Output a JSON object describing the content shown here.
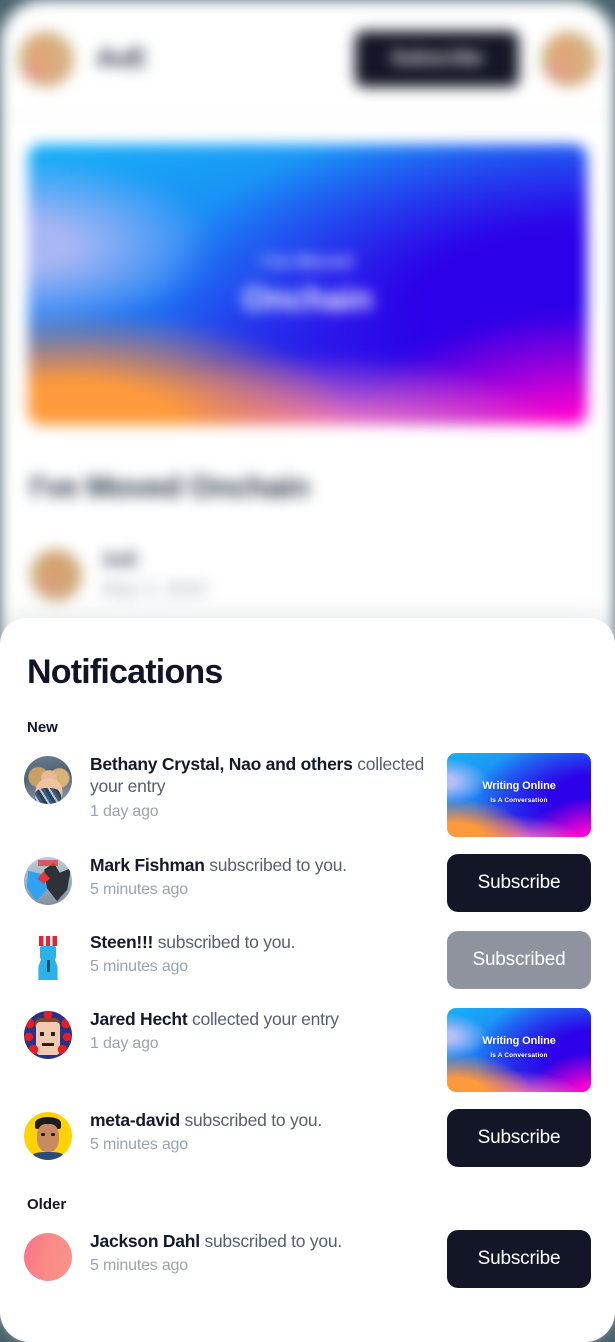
{
  "background_app": {
    "header": {
      "site_name": "AvE",
      "subscribe_label": "Subscribe",
      "avatar_icon": "avocado-avatar",
      "profile_avatar_icon": "avocado-avatar"
    },
    "hero": {
      "eyebrow": "I've Moved",
      "headline": "Onchain"
    },
    "article": {
      "title": "I've Moved Onchain",
      "author": "AvE",
      "date": "May 3, 2024",
      "author_avatar_icon": "avocado-avatar"
    }
  },
  "notifications": {
    "title": "Notifications",
    "sections": [
      {
        "label": "New",
        "items": [
          {
            "who": "Bethany Crystal, Nao and others",
            "action": " collected your entry",
            "time": "1 day ago",
            "avatar_icon": "photo-avatar-bethany",
            "avatar_class": "av-photo-woman",
            "action_type": "thumbnail",
            "thumbnail": {
              "title": "Writing Online",
              "subtitle": "Is A Conversation"
            }
          },
          {
            "who": "Mark Fishman",
            "action": " subscribed to you.",
            "time": "5 minutes ago",
            "avatar_icon": "wolf-avatar-mark",
            "avatar_class": "av-wolf",
            "action_type": "button",
            "button": {
              "label": "Subscribe",
              "state": "subscribe"
            }
          },
          {
            "who": "Steen!!!",
            "action": " subscribed to you.",
            "time": "5 minutes ago",
            "avatar_icon": "pixel-robot-avatar-steen",
            "avatar_class": "av-steen",
            "action_type": "button",
            "button": {
              "label": "Subscribed",
              "state": "subscribed"
            }
          },
          {
            "who": "Jared Hecht",
            "action": " collected your entry",
            "time": "1 day ago",
            "avatar_icon": "pixel-face-avatar-jared",
            "avatar_class": "av-jared",
            "action_type": "thumbnail",
            "thumbnail": {
              "title": "Writing Online",
              "subtitle": "Is A Conversation"
            }
          },
          {
            "who": "meta-david",
            "action": " subscribed to you.",
            "time": "5 minutes ago",
            "avatar_icon": "yellow-portrait-avatar-david",
            "avatar_class": "av-david",
            "action_type": "button",
            "button": {
              "label": "Subscribe",
              "state": "subscribe"
            }
          }
        ]
      },
      {
        "label": "Older",
        "items": [
          {
            "who": "Jackson Dahl",
            "action": " subscribed to you.",
            "time": "5 minutes ago",
            "avatar_icon": "pink-gradient-avatar-jackson",
            "avatar_class": "av-jackson",
            "action_type": "button",
            "button": {
              "label": "Subscribe",
              "state": "subscribe"
            }
          }
        ]
      }
    ]
  },
  "colors": {
    "page_background": "#4a636e",
    "panel_background": "#ffffff",
    "subscribe_button": "#131626",
    "subscribed_button": "#8e939e",
    "name_text": "#131a2b",
    "action_text": "#545f73",
    "time_text": "#9aa3b2"
  }
}
